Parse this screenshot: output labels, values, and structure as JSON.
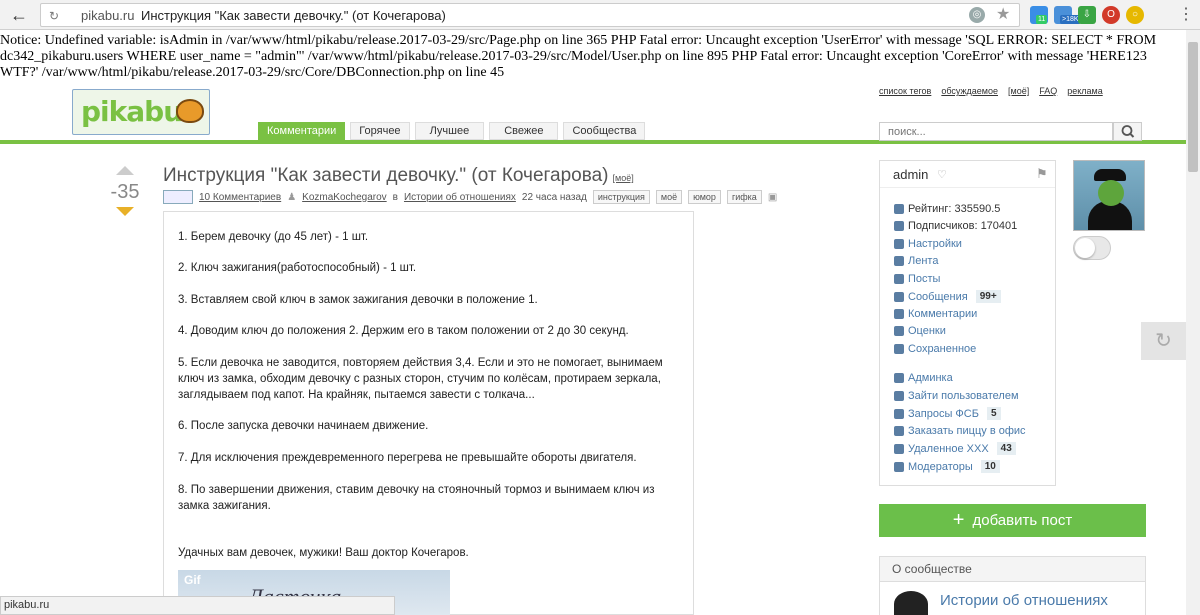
{
  "browser": {
    "domain": "pikabu.ru",
    "tab_title": "Инструкция \"Как завести девочку.\" (от Кочегарова)",
    "icons": [
      "back-arrow-icon",
      "info-icon",
      "translate-icon",
      "star-icon",
      "menu-icon"
    ],
    "extensions": [
      {
        "name": "ext-calendar-icon",
        "badge": "11",
        "color": "#3a8ee6"
      },
      {
        "name": "ext-counter-icon",
        "badge": ">18K",
        "color": "#4a90d9"
      },
      {
        "name": "ext-download-icon",
        "badge": "",
        "color": "#3aa544"
      },
      {
        "name": "ext-opera-icon",
        "badge": "",
        "color": "#d23a2a"
      },
      {
        "name": "ext-chrome-icon",
        "badge": "",
        "color": "#e6b800"
      }
    ],
    "status_url": "pikabu.ru"
  },
  "notice": "Notice: Undefined variable: isAdmin in /var/www/html/pikabu/release.2017-03-29/src/Page.php on line 365 PHP Fatal error: Uncaught exception 'UserError' with message 'SQL ERROR: SELECT * FROM dc342_pikaburu.users WHERE user_name = \"admin\"' /var/www/html/pikabu/release.2017-03-29/src/Model/User.php on line 895 PHP Fatal error: Uncaught exception 'CoreError' with message 'HERE123 WTF?' /var/www/html/pikabu/release.2017-03-29/src/Core/DBConnection.php on line 45",
  "header": {
    "logo_text": "pikabu",
    "top_links": [
      "список тегов",
      "обсуждаемое",
      "[моё]",
      "FAQ",
      "реклама"
    ],
    "tabs": [
      {
        "label": "Комментарии",
        "active": true
      },
      {
        "label": "Горячее",
        "active": false
      },
      {
        "label": "Лучшее",
        "active": false
      },
      {
        "label": "Свежее",
        "active": false
      },
      {
        "label": "Сообщества",
        "active": false
      }
    ],
    "search_placeholder": "поиск...",
    "accent_color": "#7ac143"
  },
  "post": {
    "score": "-35",
    "title": "Инструкция \"Как завести девочку.\" (от Кочегарова)",
    "title_mine": "[моё]",
    "comments": "10 Комментариев",
    "author": "KozmaKochegarov",
    "in_label": "в",
    "community": "Истории об отношениях",
    "time": "22 часа назад",
    "tags": [
      "инструкция",
      "моё",
      "юмор",
      "гифка"
    ],
    "lines": [
      "1. Берем девочку (до 45 лет) - 1 шт.",
      "2. Ключ зажигания(работоспособный) - 1 шт.",
      "3. Вставляем свой ключ в замок зажигания девочки в положение 1.",
      "4. Доводим ключ до положения 2. Держим его в таком положении от 2 до 30 секунд.",
      "5. Если девочка не заводится, повторяем действия 3,4. Если и это не помогает, вынимаем ключ из замка, обходим девочку с разных сторон, стучим по колёсам, протираем зеркала, заглядываем под капот. На крайняк, пытаемся завести с толкача...",
      "6. После запуска девочки начинаем движение.",
      "7. Для исключения преждевременного перегрева не превышайте обороты двигателя.",
      "8. По завершении движения, ставим девочку на стояночный тормоз и вынимаем ключ из замка зажигания.",
      "Удачных вам девочек, мужики! Ваш доктор Кочегаров."
    ],
    "gif_label": "Gif",
    "gif_caption": "Ласточка"
  },
  "user": {
    "name": "admin",
    "rating": "Рейтинг: 335590.5",
    "subscribers": "Подписчиков: 170401",
    "menu": [
      {
        "label": "Настройки",
        "badge": ""
      },
      {
        "label": "Лента",
        "badge": ""
      },
      {
        "label": "Посты",
        "badge": ""
      },
      {
        "label": "Сообщения",
        "badge": "99+"
      },
      {
        "label": "Комментарии",
        "badge": ""
      },
      {
        "label": "Оценки",
        "badge": ""
      },
      {
        "label": "Сохраненное",
        "badge": ""
      }
    ],
    "admin_menu": [
      {
        "label": "Админка",
        "badge": ""
      },
      {
        "label": "Зайти пользователем",
        "badge": ""
      },
      {
        "label": "Запросы ФСБ",
        "badge": "5"
      },
      {
        "label": "Заказать пиццу в офис",
        "badge": ""
      },
      {
        "label": "Удаленное XXX",
        "badge": "43"
      },
      {
        "label": "Модераторы",
        "badge": "10"
      }
    ]
  },
  "sidebar": {
    "add_post": "добавить пост",
    "community_heading": "О сообществе",
    "community_name": "Истории об отношениях"
  }
}
